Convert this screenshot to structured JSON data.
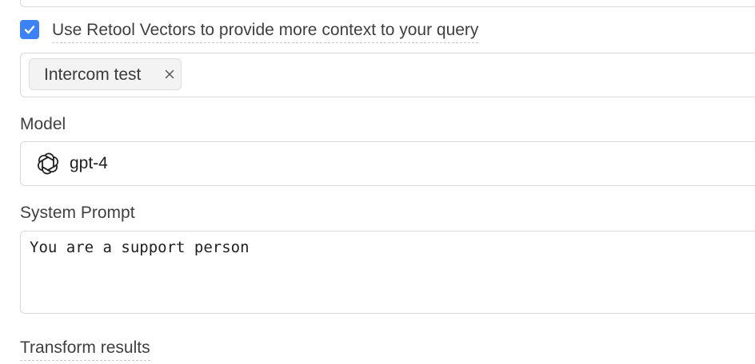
{
  "vectors": {
    "checkbox_checked": true,
    "checkbox_label": "Use Retool Vectors to provide more context to your query",
    "selected_tags": [
      {
        "label": "Intercom test"
      }
    ]
  },
  "model": {
    "label": "Model",
    "value": "gpt-4",
    "icon": "openai-icon"
  },
  "system_prompt": {
    "label": "System Prompt",
    "value": "You are a support person"
  },
  "transform": {
    "label": "Transform results"
  },
  "colors": {
    "accent": "#3c82f6",
    "border": "#d9d9d9",
    "tag_bg": "#f3f3f3"
  }
}
